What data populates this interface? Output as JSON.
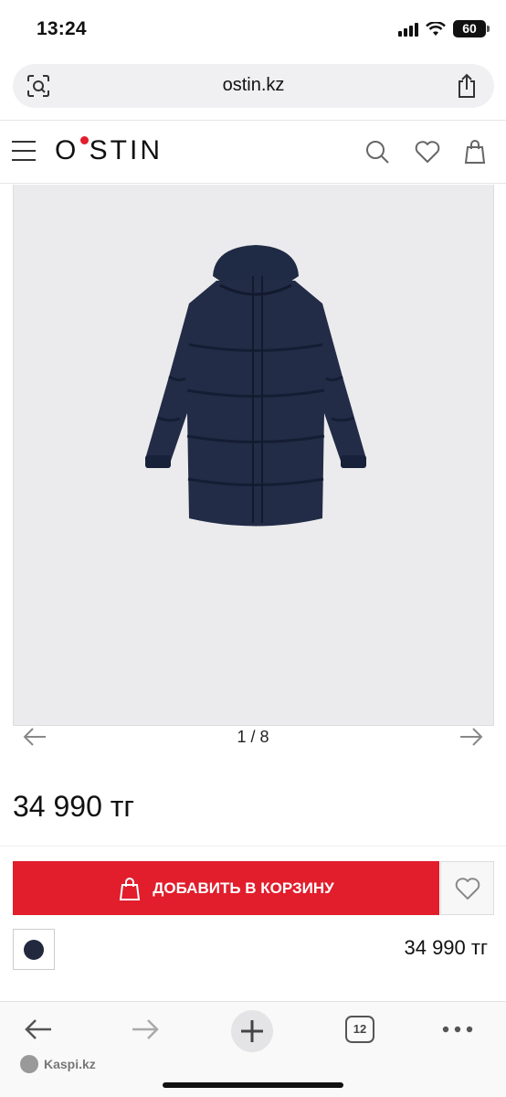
{
  "status_bar": {
    "time": "13:24",
    "battery": "60"
  },
  "browser": {
    "url": "ostin.kz",
    "tabs_count": "12"
  },
  "site": {
    "logo": "O STIN",
    "brand_color": "#e21d2c"
  },
  "gallery": {
    "pager": "1 / 8"
  },
  "product": {
    "price": "34 990 тг",
    "add_to_cart_label": "ДОБАВИТЬ В КОРЗИНУ",
    "color_swatch": "#22293f",
    "variant_price": "34 990 тг"
  },
  "watermark": {
    "text": "Kaspi.kz"
  },
  "icons": [
    "search-icon",
    "heart-icon",
    "bag-icon",
    "menu-icon",
    "share-icon",
    "arrow-left-icon",
    "arrow-right-icon",
    "plus-icon",
    "more-icon"
  ]
}
